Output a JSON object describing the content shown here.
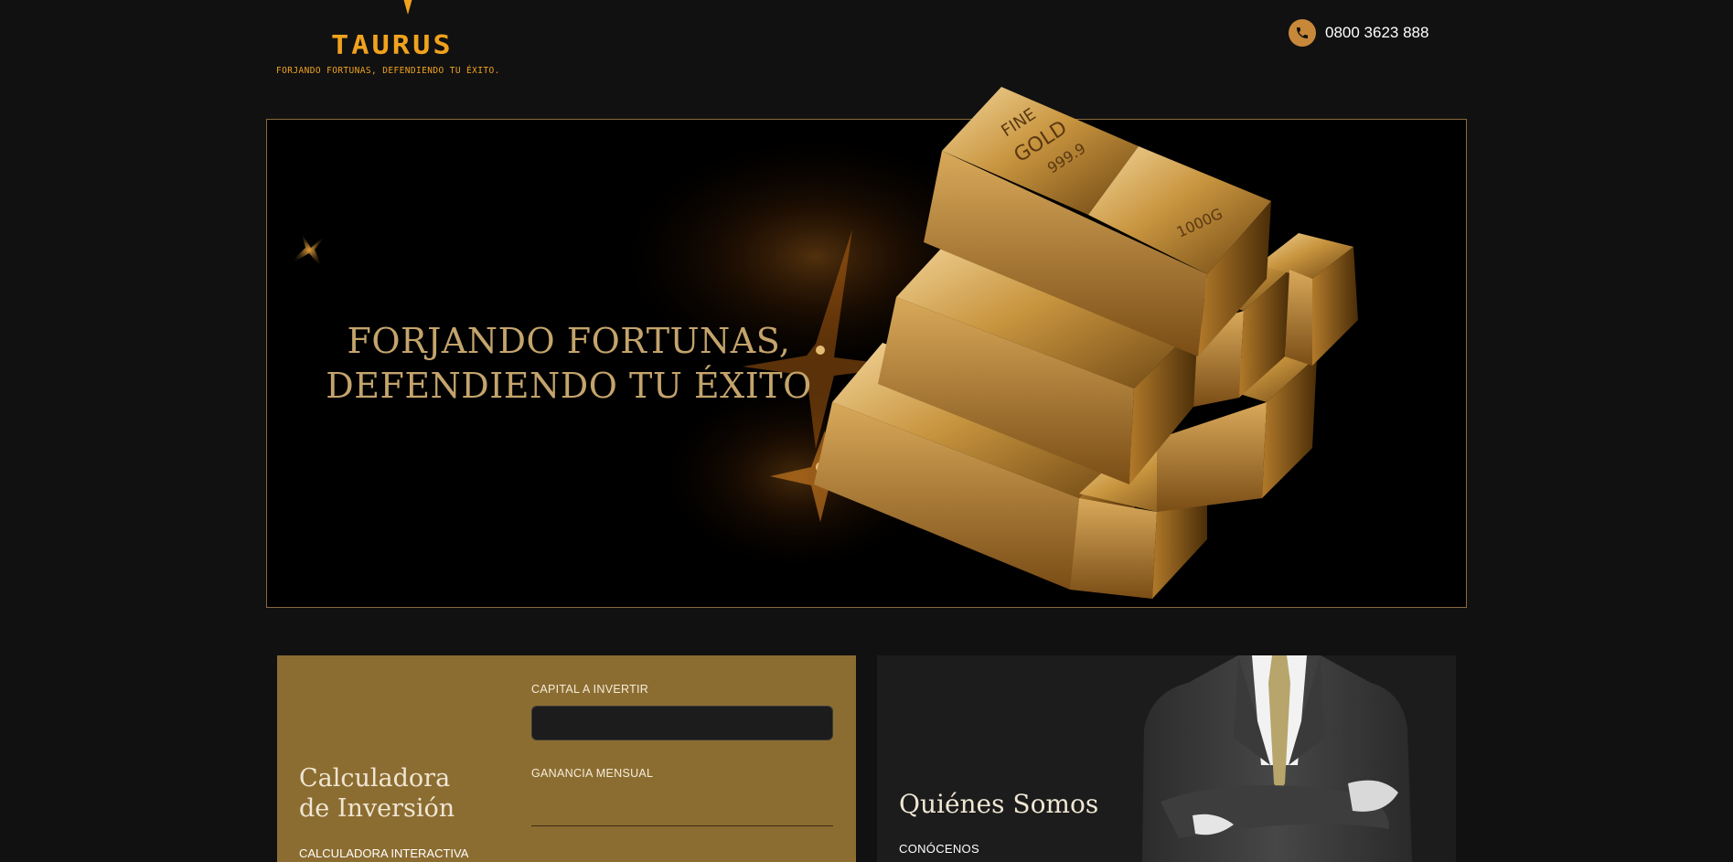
{
  "brand": {
    "name": "TAURUS",
    "tagline": "FORJANDO FORTUNAS, DEFENDIENDO TU ÉXITO.",
    "accent_color": "#f0a21e"
  },
  "header": {
    "phone_icon": "phone-icon",
    "phone_number": "0800 3623 888"
  },
  "hero": {
    "headline_line1": "FORJANDO FORTUNAS,",
    "headline_line2": "DEFENDIENDO TU ÉXITO",
    "gold_bar_text_top": "FINE",
    "gold_bar_text_mid": "GOLD",
    "gold_bar_purity": "999.9",
    "gold_bar_weight": "1000G",
    "headline_color": "#c4a46c"
  },
  "calculator": {
    "title_line1": "Calculadora",
    "title_line2": "de Inversión",
    "subtitle": "CALCULADORA INTERACTIVA",
    "capital_label": "CAPITAL A INVERTIR",
    "capital_value": "",
    "gain_label": "GANANCIA MENSUAL",
    "gain_value": "",
    "background": "#8c6d31"
  },
  "about": {
    "title": "Quiénes Somos",
    "subtitle": "CONÓCENOS",
    "background": "#1c1c1c"
  }
}
